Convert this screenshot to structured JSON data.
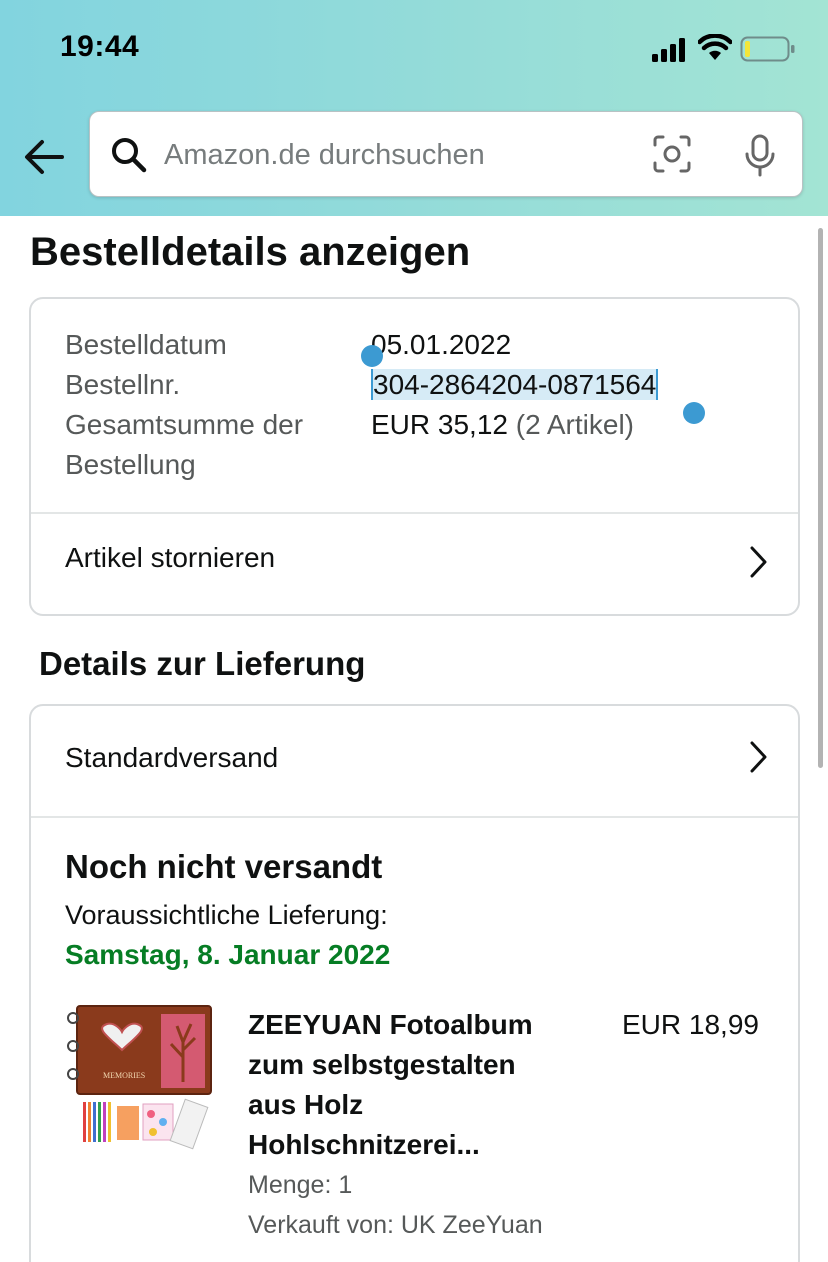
{
  "status_bar": {
    "time": "19:44"
  },
  "search": {
    "placeholder": "Amazon.de durchsuchen",
    "value": ""
  },
  "page": {
    "title": "Bestelldetails anzeigen"
  },
  "order_summary": {
    "order_date_label": "Bestelldatum",
    "order_date_value": "05.01.2022",
    "order_number_label": "Bestellnr.",
    "order_number_value": "304-2864204-0871564",
    "total_label": "Gesamtsumme der Bestellung",
    "total_value": "EUR 35,12",
    "total_items": "(2 Artikel)",
    "cancel_items_label": "Artikel stornieren"
  },
  "delivery": {
    "section_title": "Details zur Lieferung",
    "shipping_method": "Standardversand",
    "shipment_status": "Noch nicht versandt",
    "eta_label": "Voraussichtliche Lieferung:",
    "eta_date": "Samstag, 8. Januar 2022"
  },
  "items": [
    {
      "title": "ZEEYUAN Fotoalbum zum selbstgestalten aus Holz Hohlschnitzerei...",
      "price": "EUR 18,99",
      "quantity": "Menge: 1",
      "seller": "Verkauft von: UK ZeeYuan",
      "image_text": "MEMORIES"
    }
  ],
  "colors": {
    "header_gradient_start": "#82d4df",
    "header_gradient_end": "#a3e4d4",
    "delivery_date_green": "#067d24",
    "selection_blue": "#3c9ad2"
  }
}
